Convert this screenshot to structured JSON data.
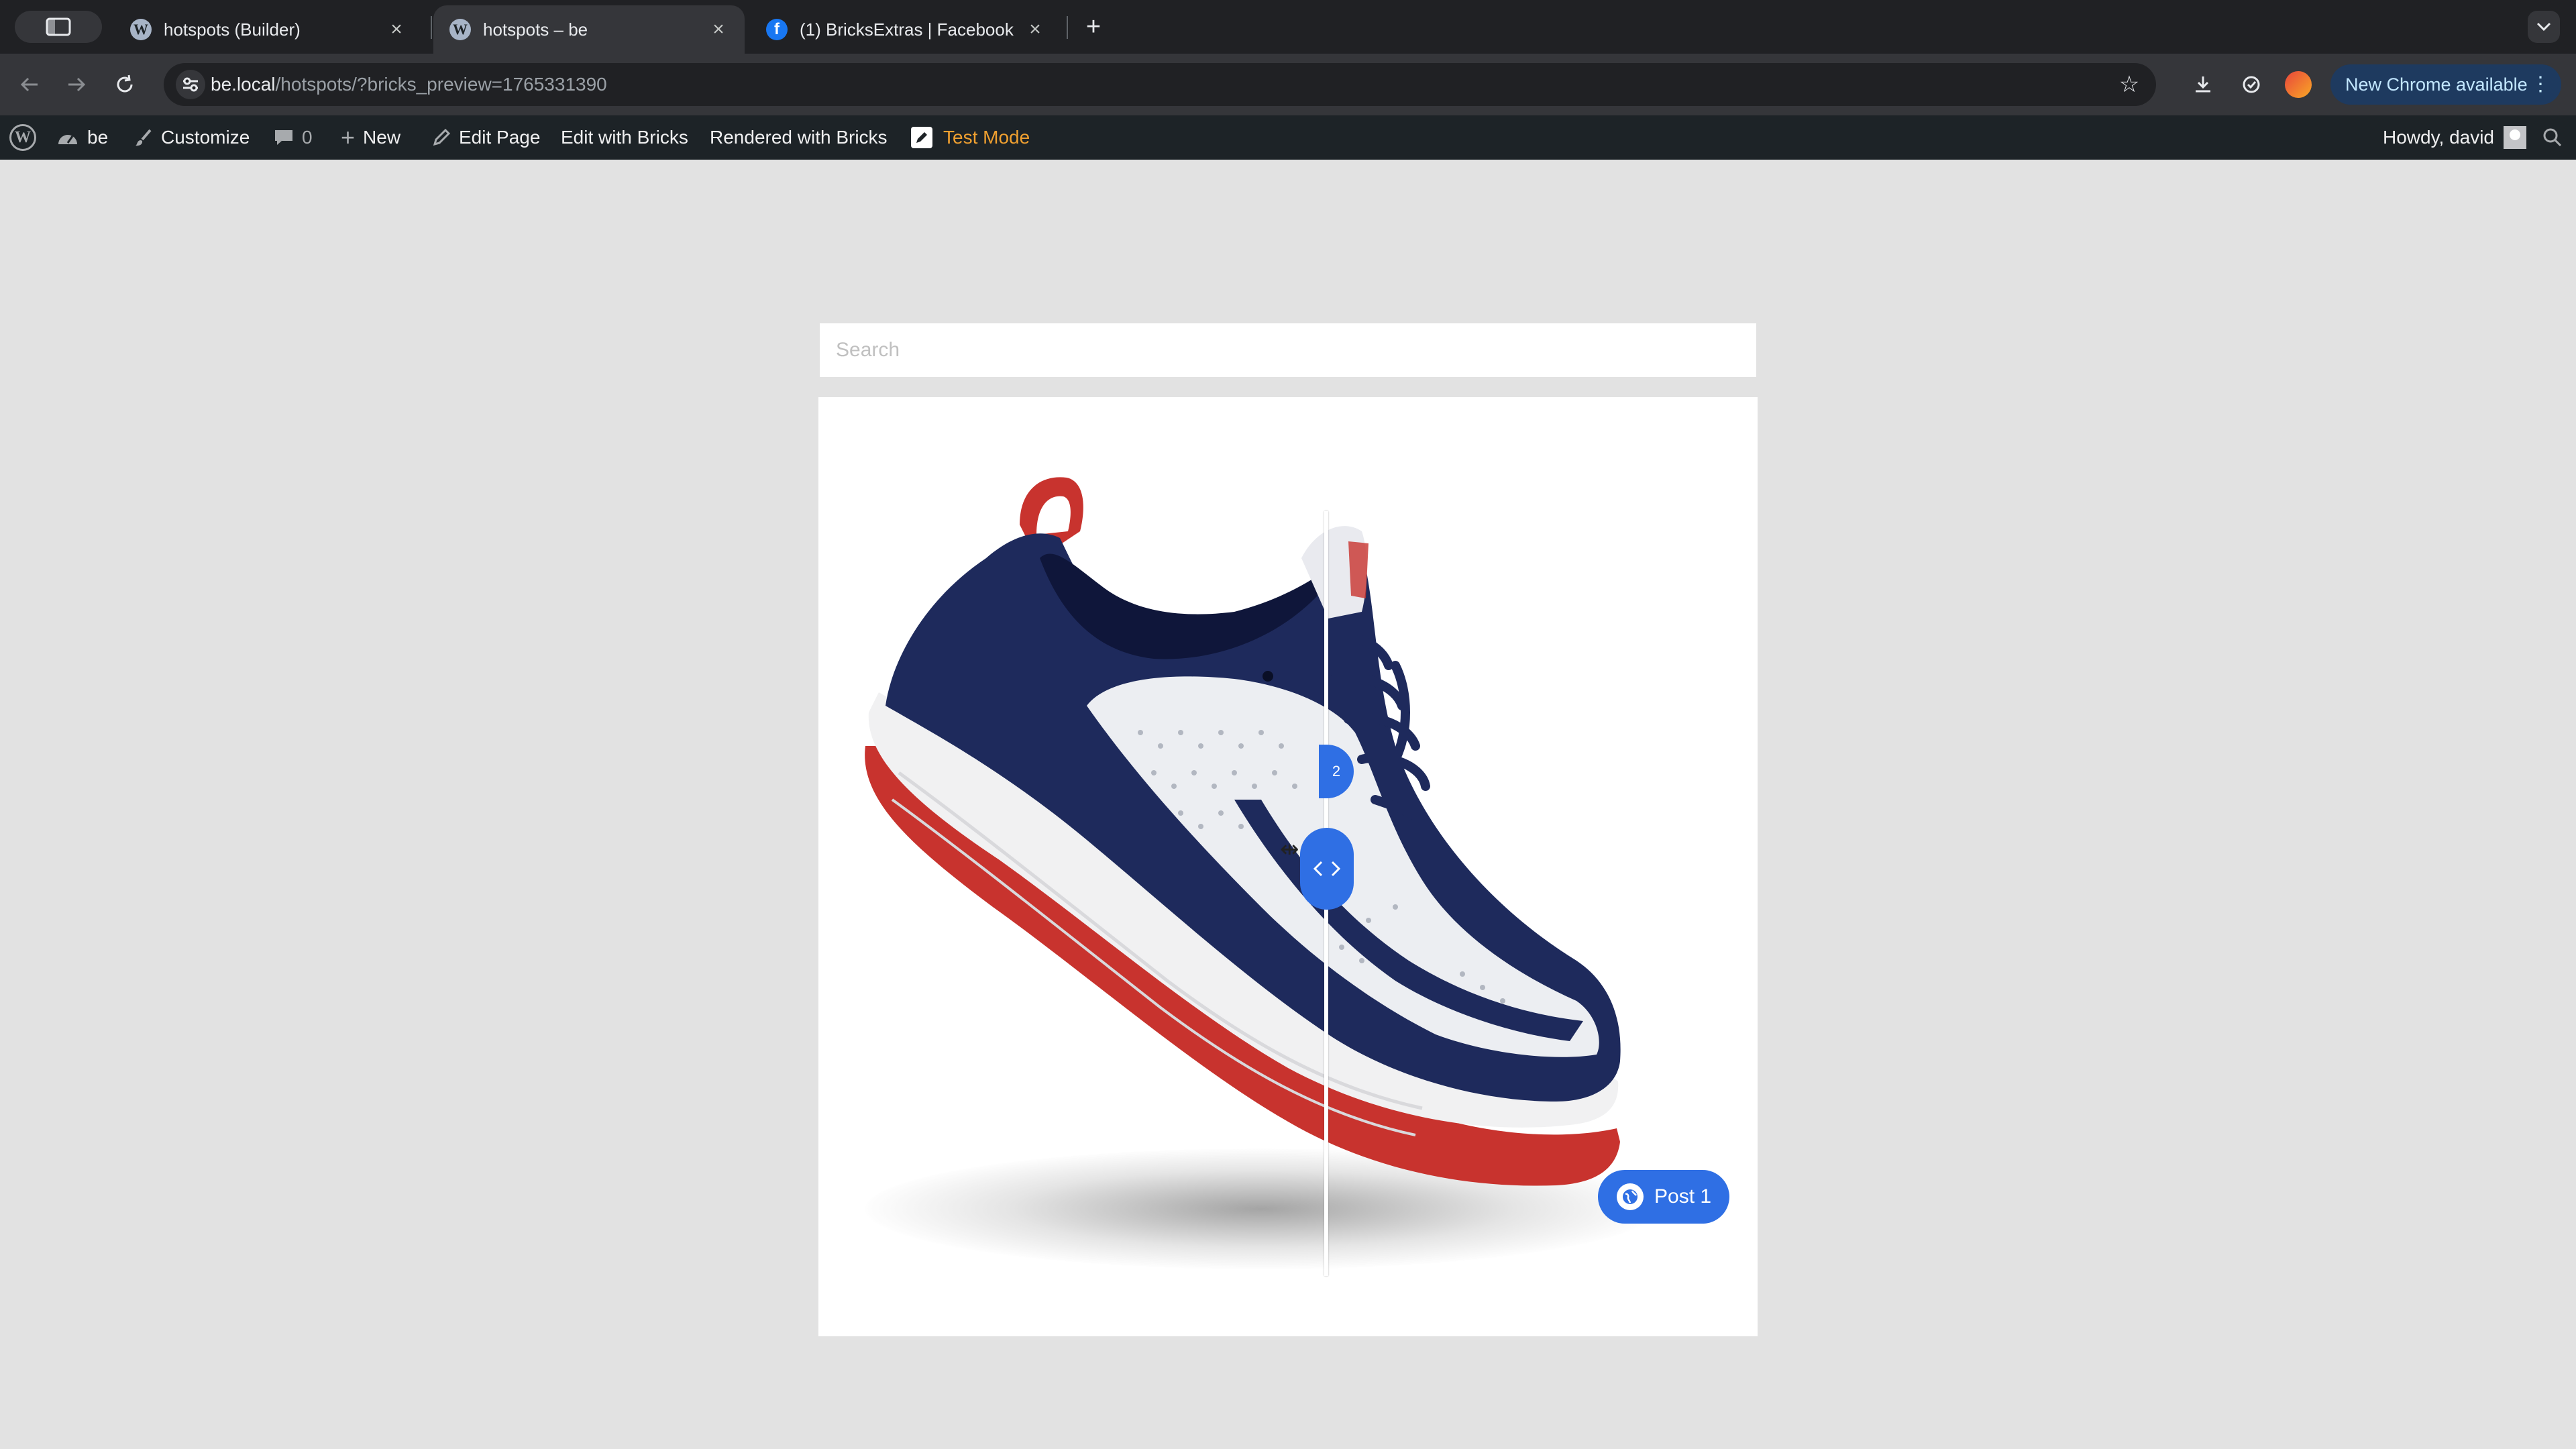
{
  "browser": {
    "tabs": [
      {
        "title": "hotspots (Builder)",
        "favicon": "wordpress-icon",
        "active": false
      },
      {
        "title": "hotspots – be",
        "favicon": "wordpress-icon",
        "active": true
      },
      {
        "title": "(1) BricksExtras | Facebook",
        "favicon": "facebook-icon",
        "active": false
      }
    ],
    "url_host": "be.local",
    "url_path": "/hotspots/?bricks_preview=1765331390",
    "update_label": "New Chrome available"
  },
  "adminbar": {
    "site_name": "be",
    "customize": "Customize",
    "comments_count": "0",
    "new": "New",
    "edit_page": "Edit Page",
    "edit_with_bricks": "Edit with Bricks",
    "rendered_with_bricks": "Rendered with Bricks",
    "test_mode": "Test Mode",
    "howdy": "Howdy, david"
  },
  "page": {
    "search_placeholder": "Search",
    "hotspot_label": "Post 1",
    "slider_position": 0.54
  },
  "colors": {
    "accent": "#2f6fe4",
    "admin_bar": "#1d2327",
    "page_bg": "#e2e2e2",
    "shoe_navy": "#1e2a5c",
    "shoe_red": "#c8332e"
  }
}
